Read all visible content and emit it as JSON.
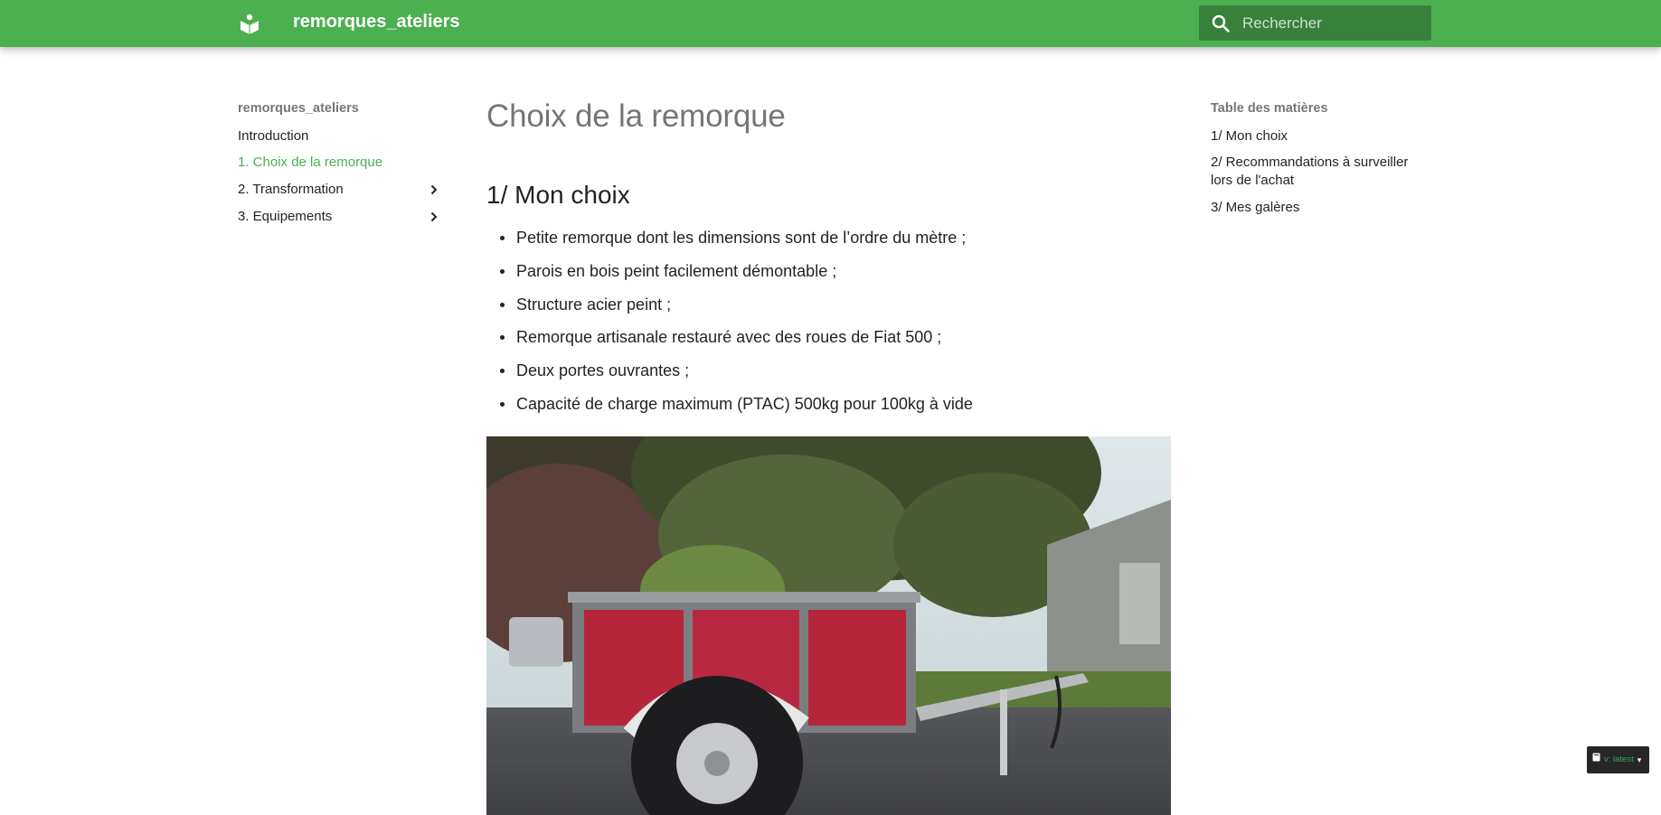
{
  "header": {
    "site_title": "remorques_ateliers",
    "search_placeholder": "Rechercher",
    "colors": {
      "primary": "#4caf50"
    }
  },
  "nav": {
    "title": "remorques_ateliers",
    "items": [
      {
        "label": "Introduction",
        "active": false,
        "expandable": false
      },
      {
        "label": "1. Choix de la remorque",
        "active": true,
        "expandable": false
      },
      {
        "label": "2. Transformation",
        "active": false,
        "expandable": true
      },
      {
        "label": "3. Equipements",
        "active": false,
        "expandable": true
      }
    ]
  },
  "main": {
    "page_title": "Choix de la remorque",
    "section_title": "1/ Mon choix",
    "bullets": [
      "Petite remorque dont les dimensions sont de l’ordre du mètre ;",
      "Parois en bois peint facilement démontable ;",
      "Structure acier peint ;",
      "Remorque artisanale restauré avec des roues de Fiat 500 ;",
      "Deux portes ouvrantes ;",
      "Capacité de charge maximum (PTAC) 500kg pour 100kg à vide"
    ]
  },
  "toc": {
    "title": "Table des matières",
    "items": [
      "1/ Mon choix",
      "2/ Recommandations à surveiller lors de l'achat",
      "3/ Mes galères"
    ]
  },
  "version_badge": {
    "label": "v: latest",
    "icon": "book-icon"
  }
}
